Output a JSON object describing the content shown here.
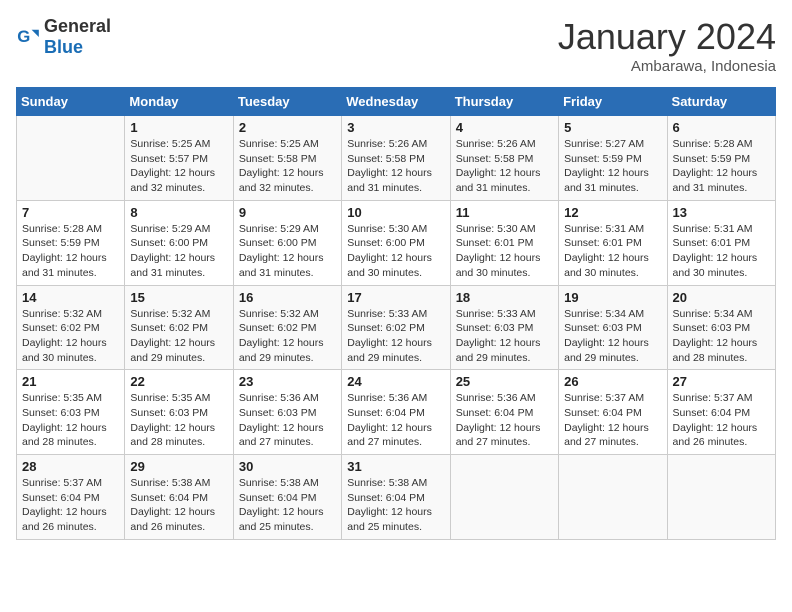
{
  "header": {
    "logo_general": "General",
    "logo_blue": "Blue",
    "month_year": "January 2024",
    "location": "Ambarawa, Indonesia"
  },
  "days_of_week": [
    "Sunday",
    "Monday",
    "Tuesday",
    "Wednesday",
    "Thursday",
    "Friday",
    "Saturday"
  ],
  "weeks": [
    [
      {
        "day": "",
        "info": ""
      },
      {
        "day": "1",
        "info": "Sunrise: 5:25 AM\nSunset: 5:57 PM\nDaylight: 12 hours and 32 minutes."
      },
      {
        "day": "2",
        "info": "Sunrise: 5:25 AM\nSunset: 5:58 PM\nDaylight: 12 hours and 32 minutes."
      },
      {
        "day": "3",
        "info": "Sunrise: 5:26 AM\nSunset: 5:58 PM\nDaylight: 12 hours and 31 minutes."
      },
      {
        "day": "4",
        "info": "Sunrise: 5:26 AM\nSunset: 5:58 PM\nDaylight: 12 hours and 31 minutes."
      },
      {
        "day": "5",
        "info": "Sunrise: 5:27 AM\nSunset: 5:59 PM\nDaylight: 12 hours and 31 minutes."
      },
      {
        "day": "6",
        "info": "Sunrise: 5:28 AM\nSunset: 5:59 PM\nDaylight: 12 hours and 31 minutes."
      }
    ],
    [
      {
        "day": "7",
        "info": "Sunrise: 5:28 AM\nSunset: 5:59 PM\nDaylight: 12 hours and 31 minutes."
      },
      {
        "day": "8",
        "info": "Sunrise: 5:29 AM\nSunset: 6:00 PM\nDaylight: 12 hours and 31 minutes."
      },
      {
        "day": "9",
        "info": "Sunrise: 5:29 AM\nSunset: 6:00 PM\nDaylight: 12 hours and 31 minutes."
      },
      {
        "day": "10",
        "info": "Sunrise: 5:30 AM\nSunset: 6:00 PM\nDaylight: 12 hours and 30 minutes."
      },
      {
        "day": "11",
        "info": "Sunrise: 5:30 AM\nSunset: 6:01 PM\nDaylight: 12 hours and 30 minutes."
      },
      {
        "day": "12",
        "info": "Sunrise: 5:31 AM\nSunset: 6:01 PM\nDaylight: 12 hours and 30 minutes."
      },
      {
        "day": "13",
        "info": "Sunrise: 5:31 AM\nSunset: 6:01 PM\nDaylight: 12 hours and 30 minutes."
      }
    ],
    [
      {
        "day": "14",
        "info": "Sunrise: 5:32 AM\nSunset: 6:02 PM\nDaylight: 12 hours and 30 minutes."
      },
      {
        "day": "15",
        "info": "Sunrise: 5:32 AM\nSunset: 6:02 PM\nDaylight: 12 hours and 29 minutes."
      },
      {
        "day": "16",
        "info": "Sunrise: 5:32 AM\nSunset: 6:02 PM\nDaylight: 12 hours and 29 minutes."
      },
      {
        "day": "17",
        "info": "Sunrise: 5:33 AM\nSunset: 6:02 PM\nDaylight: 12 hours and 29 minutes."
      },
      {
        "day": "18",
        "info": "Sunrise: 5:33 AM\nSunset: 6:03 PM\nDaylight: 12 hours and 29 minutes."
      },
      {
        "day": "19",
        "info": "Sunrise: 5:34 AM\nSunset: 6:03 PM\nDaylight: 12 hours and 29 minutes."
      },
      {
        "day": "20",
        "info": "Sunrise: 5:34 AM\nSunset: 6:03 PM\nDaylight: 12 hours and 28 minutes."
      }
    ],
    [
      {
        "day": "21",
        "info": "Sunrise: 5:35 AM\nSunset: 6:03 PM\nDaylight: 12 hours and 28 minutes."
      },
      {
        "day": "22",
        "info": "Sunrise: 5:35 AM\nSunset: 6:03 PM\nDaylight: 12 hours and 28 minutes."
      },
      {
        "day": "23",
        "info": "Sunrise: 5:36 AM\nSunset: 6:03 PM\nDaylight: 12 hours and 27 minutes."
      },
      {
        "day": "24",
        "info": "Sunrise: 5:36 AM\nSunset: 6:04 PM\nDaylight: 12 hours and 27 minutes."
      },
      {
        "day": "25",
        "info": "Sunrise: 5:36 AM\nSunset: 6:04 PM\nDaylight: 12 hours and 27 minutes."
      },
      {
        "day": "26",
        "info": "Sunrise: 5:37 AM\nSunset: 6:04 PM\nDaylight: 12 hours and 27 minutes."
      },
      {
        "day": "27",
        "info": "Sunrise: 5:37 AM\nSunset: 6:04 PM\nDaylight: 12 hours and 26 minutes."
      }
    ],
    [
      {
        "day": "28",
        "info": "Sunrise: 5:37 AM\nSunset: 6:04 PM\nDaylight: 12 hours and 26 minutes."
      },
      {
        "day": "29",
        "info": "Sunrise: 5:38 AM\nSunset: 6:04 PM\nDaylight: 12 hours and 26 minutes."
      },
      {
        "day": "30",
        "info": "Sunrise: 5:38 AM\nSunset: 6:04 PM\nDaylight: 12 hours and 25 minutes."
      },
      {
        "day": "31",
        "info": "Sunrise: 5:38 AM\nSunset: 6:04 PM\nDaylight: 12 hours and 25 minutes."
      },
      {
        "day": "",
        "info": ""
      },
      {
        "day": "",
        "info": ""
      },
      {
        "day": "",
        "info": ""
      }
    ]
  ]
}
